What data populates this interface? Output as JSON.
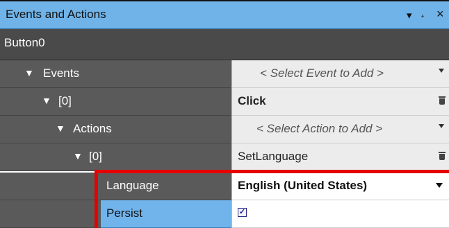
{
  "window": {
    "title": "Events and Actions",
    "pin_glyph": "↓",
    "dock_glyph": "p",
    "close_glyph": "×"
  },
  "object_name": "Button0",
  "rows": {
    "events": {
      "label": "Events",
      "value": "< Select Event to Add >"
    },
    "event0": {
      "label": "[0]",
      "value": "Click"
    },
    "actions": {
      "label": "Actions",
      "value": "< Select Action to Add >"
    },
    "action0": {
      "label": "[0]",
      "value": "SetLanguage"
    },
    "language": {
      "label": "Language",
      "value": "English (United States)"
    },
    "persist": {
      "label": "Persist",
      "checked": true,
      "check_glyph": "✓"
    }
  },
  "colors": {
    "titlebar": "#6fb3e8",
    "selected_label": "#71b4ec",
    "highlight_frame": "#e60000"
  }
}
